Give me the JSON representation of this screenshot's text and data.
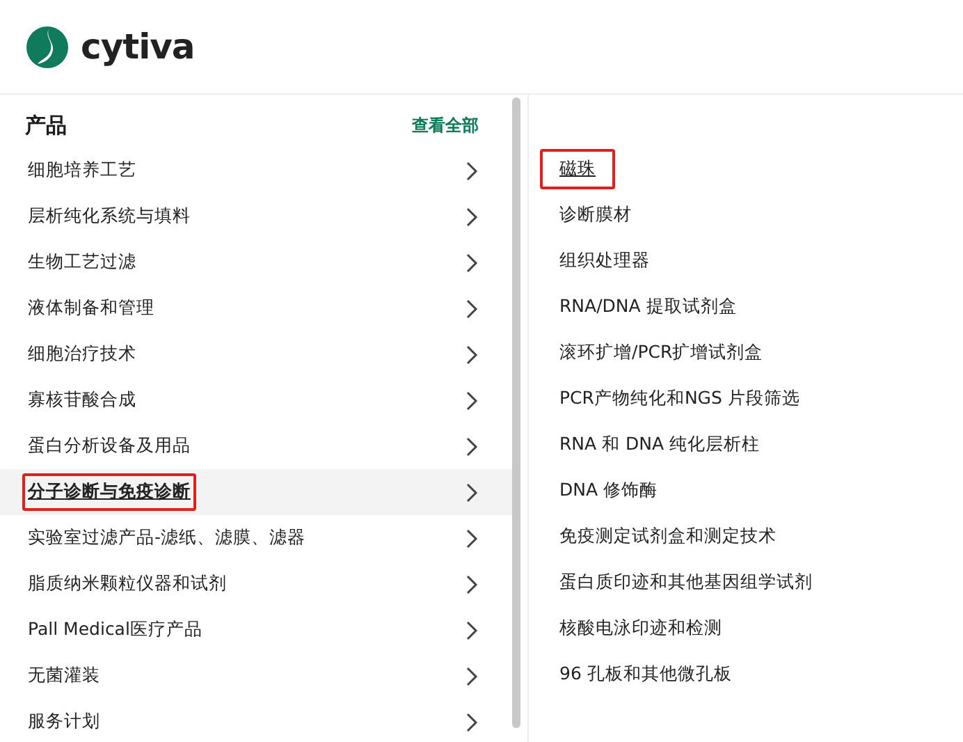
{
  "logo": {
    "name": "cytiva"
  },
  "products": {
    "heading": "产品",
    "view_all": "查看全部",
    "items": [
      {
        "label": "细胞培养工艺",
        "selected": false,
        "marked": false
      },
      {
        "label": "层析纯化系统与填料",
        "selected": false,
        "marked": false
      },
      {
        "label": "生物工艺过滤",
        "selected": false,
        "marked": false
      },
      {
        "label": "液体制备和管理",
        "selected": false,
        "marked": false
      },
      {
        "label": "细胞治疗技术",
        "selected": false,
        "marked": false
      },
      {
        "label": "寡核苷酸合成",
        "selected": false,
        "marked": false
      },
      {
        "label": "蛋白分析设备及用品",
        "selected": false,
        "marked": false
      },
      {
        "label": "分子诊断与免疫诊断",
        "selected": true,
        "marked": true
      },
      {
        "label": "实验室过滤产品-滤纸、滤膜、滤器",
        "selected": false,
        "marked": false
      },
      {
        "label": "脂质纳米颗粒仪器和试剂",
        "selected": false,
        "marked": false
      },
      {
        "label": "Pall Medical医疗产品",
        "selected": false,
        "marked": false
      },
      {
        "label": "无菌灌装",
        "selected": false,
        "marked": false
      },
      {
        "label": "服务计划",
        "selected": false,
        "marked": false
      }
    ]
  },
  "subitems": [
    {
      "label": "磁珠",
      "selected": true,
      "marked": true
    },
    {
      "label": "诊断膜材",
      "selected": false,
      "marked": false
    },
    {
      "label": "组织处理器",
      "selected": false,
      "marked": false
    },
    {
      "label": "RNA/DNA 提取试剂盒",
      "selected": false,
      "marked": false
    },
    {
      "label": "滚环扩增/PCR扩增试剂盒",
      "selected": false,
      "marked": false
    },
    {
      "label": "PCR产物纯化和NGS 片段筛选",
      "selected": false,
      "marked": false
    },
    {
      "label": "RNA 和 DNA 纯化层析柱",
      "selected": false,
      "marked": false
    },
    {
      "label": "DNA 修饰酶",
      "selected": false,
      "marked": false
    },
    {
      "label": "免疫测定试剂盒和测定技术",
      "selected": false,
      "marked": false
    },
    {
      "label": "蛋白质印迹和其他基因组学试剂",
      "selected": false,
      "marked": false
    },
    {
      "label": "核酸电泳印迹和检测",
      "selected": false,
      "marked": false
    },
    {
      "label": "96 孔板和其他微孔板",
      "selected": false,
      "marked": false
    }
  ]
}
